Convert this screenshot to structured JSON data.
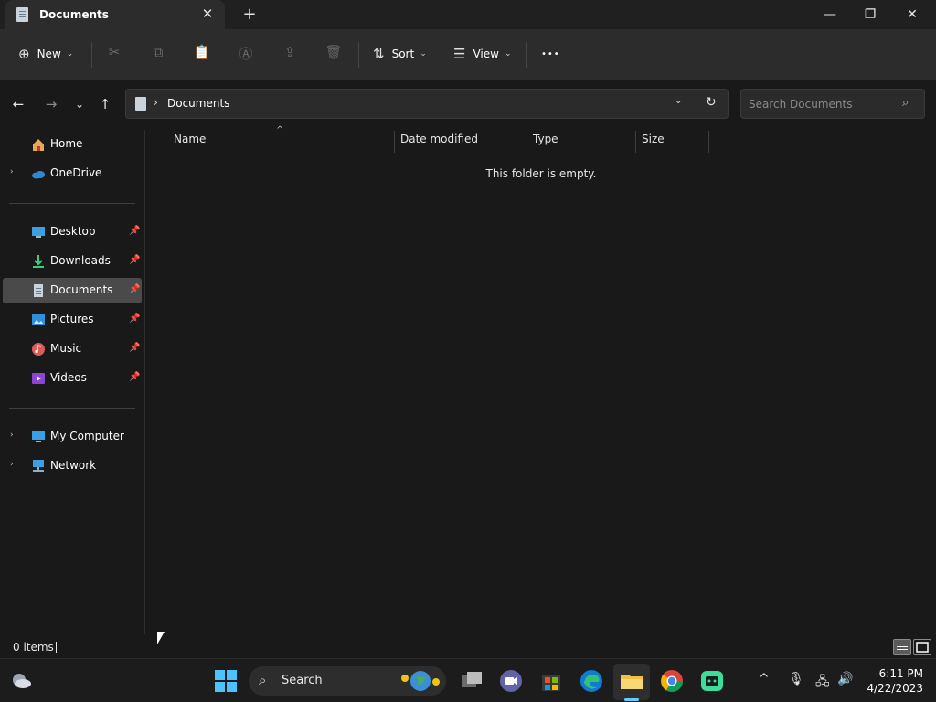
{
  "window": {
    "tab_title": "Documents",
    "close_glyph": "✕",
    "new_tab_glyph": "+",
    "controls": {
      "minimize": "—",
      "maximize": "❐",
      "close": "✕"
    }
  },
  "toolbar": {
    "new_label": "New",
    "sort_label": "Sort",
    "view_label": "View",
    "more_label": "•••",
    "icons": {
      "new": "⊕",
      "cut": "✂",
      "copy": "⧉",
      "paste": "📋",
      "rename": "Ⓐ",
      "share": "⇪",
      "delete": "🗑",
      "sort": "⇅",
      "view": "☰",
      "chevron": "⌄"
    }
  },
  "nav": {
    "back": "←",
    "forward": "→",
    "recent": "⌄",
    "up": "↑"
  },
  "address": {
    "separator": "›",
    "path": "Documents",
    "dropdown": "⌄",
    "refresh": "↻"
  },
  "search": {
    "placeholder": "Search Documents",
    "icon": "⌕"
  },
  "sidebar": {
    "expand_glyph": "›",
    "pin_glyph": "📌",
    "items": [
      {
        "label": "Home"
      },
      {
        "label": "OneDrive"
      },
      {
        "label": "Desktop"
      },
      {
        "label": "Downloads"
      },
      {
        "label": "Documents"
      },
      {
        "label": "Pictures"
      },
      {
        "label": "Music"
      },
      {
        "label": "Videos"
      },
      {
        "label": "My Computer"
      },
      {
        "label": "Network"
      }
    ]
  },
  "columns": [
    "Name",
    "Date modified",
    "Type",
    "Size"
  ],
  "sort_glyph": "^",
  "empty_message": "This folder is empty.",
  "status": {
    "count": "0 items"
  },
  "taskbar": {
    "search_label": "Search",
    "search_icon": "⌕",
    "tray": {
      "overflow": "^",
      "mic": "🎙",
      "network": "🖧",
      "volume": "🔊"
    },
    "time": "6:11 PM",
    "date": "4/22/2023"
  },
  "colors": {
    "accent": "#60cdff",
    "window_bg": "#191919",
    "toolbar_bg": "#2c2c2c",
    "selected": "#4a4a4a"
  }
}
